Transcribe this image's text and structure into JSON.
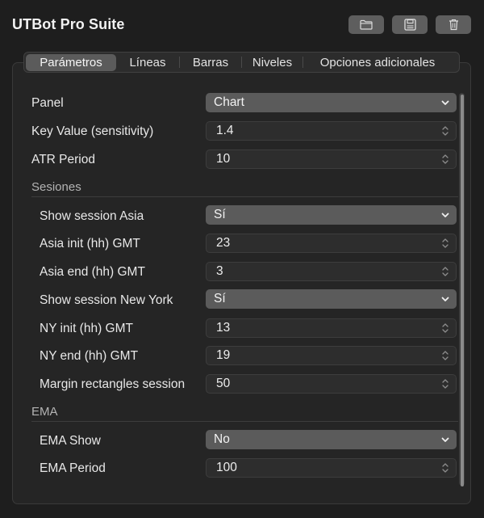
{
  "app": {
    "title": "UTBot  Pro Suite"
  },
  "toolbar": [
    {
      "icon": "folder-icon"
    },
    {
      "icon": "save-icon"
    },
    {
      "icon": "trash-icon"
    }
  ],
  "tabs": [
    {
      "label": "Parámetros",
      "active": true
    },
    {
      "label": "Líneas",
      "active": false
    },
    {
      "label": "Barras",
      "active": false
    },
    {
      "label": "Niveles",
      "active": false
    },
    {
      "label": "Opciones adicionales",
      "active": false
    }
  ],
  "params": {
    "panel": {
      "label": "Panel",
      "value": "Chart"
    },
    "key_value": {
      "label": "Key Value (sensitivity)",
      "value": "1.4"
    },
    "atr_period": {
      "label": "ATR Period",
      "value": "10"
    }
  },
  "sessions": {
    "header": "Sesiones",
    "show_asia": {
      "label": "Show session Asia",
      "value": "Sí"
    },
    "asia_init": {
      "label": "Asia init (hh) GMT",
      "value": "23"
    },
    "asia_end": {
      "label": "Asia end (hh) GMT",
      "value": "3"
    },
    "show_ny": {
      "label": "Show session New York",
      "value": "Sí"
    },
    "ny_init": {
      "label": "NY init (hh) GMT",
      "value": "13"
    },
    "ny_end": {
      "label": "NY end (hh) GMT",
      "value": "19"
    },
    "margin": {
      "label": "Margin rectangles session",
      "value": "50"
    }
  },
  "ema": {
    "header": "EMA",
    "show": {
      "label": "EMA Show",
      "value": "No"
    },
    "period": {
      "label": "EMA Period",
      "value": "100"
    }
  },
  "colors": {
    "background": "#1e1e1e",
    "panel": "#252525",
    "select": "#5b5b5b",
    "stepper": "#2d2d2d",
    "text": "#e6e6e6"
  }
}
